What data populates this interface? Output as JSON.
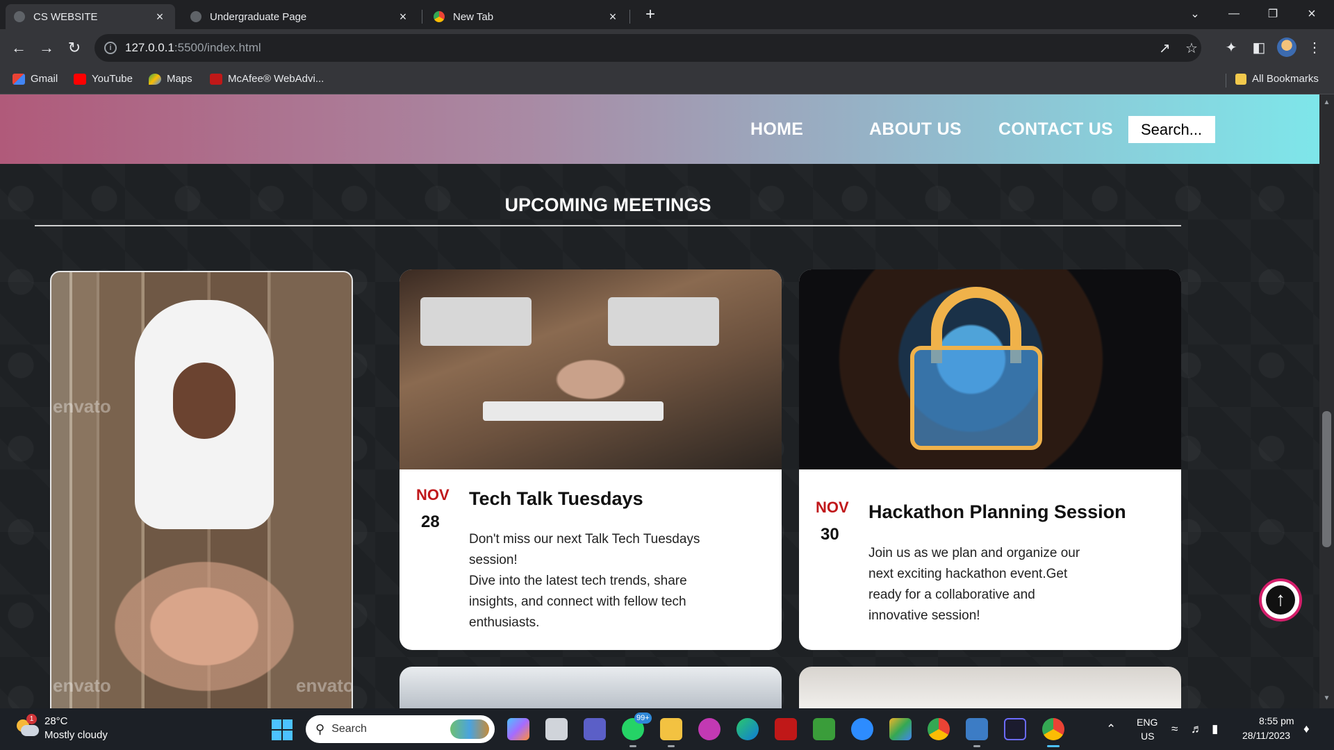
{
  "browser": {
    "tabs": [
      {
        "title": "CS WEBSITE",
        "active": true
      },
      {
        "title": "Undergraduate Page",
        "active": false
      },
      {
        "title": "New Tab",
        "active": false
      }
    ],
    "url_host": "127.0.0.1",
    "url_path": ":5500/index.html",
    "bookmarks": [
      {
        "label": "Gmail",
        "icon": "gmail-icon",
        "color": "#ea4335"
      },
      {
        "label": "YouTube",
        "icon": "youtube-icon",
        "color": "#ff0000"
      },
      {
        "label": "Maps",
        "icon": "maps-icon",
        "color": "#34a853"
      },
      {
        "label": "McAfee® WebAdvi...",
        "icon": "mcafee-icon",
        "color": "#c01818"
      }
    ],
    "all_bookmarks_label": "All Bookmarks"
  },
  "site": {
    "nav": {
      "home": "HOME",
      "about": "ABOUT US",
      "contact": "CONTACT US"
    },
    "search_placeholder": "Search...",
    "section_title": "UPCOMING MEETINGS",
    "meetings": [
      {
        "month": "NOV",
        "day": "28",
        "title": "Tech Talk Tuesdays",
        "description_lines": [
          "Don't miss our next Talk Tech Tuesdays",
          "session!",
          "Dive into the latest tech trends, share",
          "insights, and connect with fellow tech",
          "enthusiasts."
        ]
      },
      {
        "month": "NOV",
        "day": "30",
        "title": "Hackathon Planning Session",
        "description_lines": [
          "Join us as we plan and organize our",
          "next exciting hackathon event.Get",
          "ready for a collaborative and",
          "innovative session!"
        ]
      }
    ],
    "watermark": "envato",
    "accent_color": "#c0181b"
  },
  "taskbar": {
    "weather_badge": "1",
    "temperature": "28°C",
    "condition": "Mostly cloudy",
    "search_label": "Search",
    "whatsapp_badge": "99+",
    "language_top": "ENG",
    "language_bottom": "US",
    "time": "8:55 pm",
    "date": "28/11/2023"
  }
}
